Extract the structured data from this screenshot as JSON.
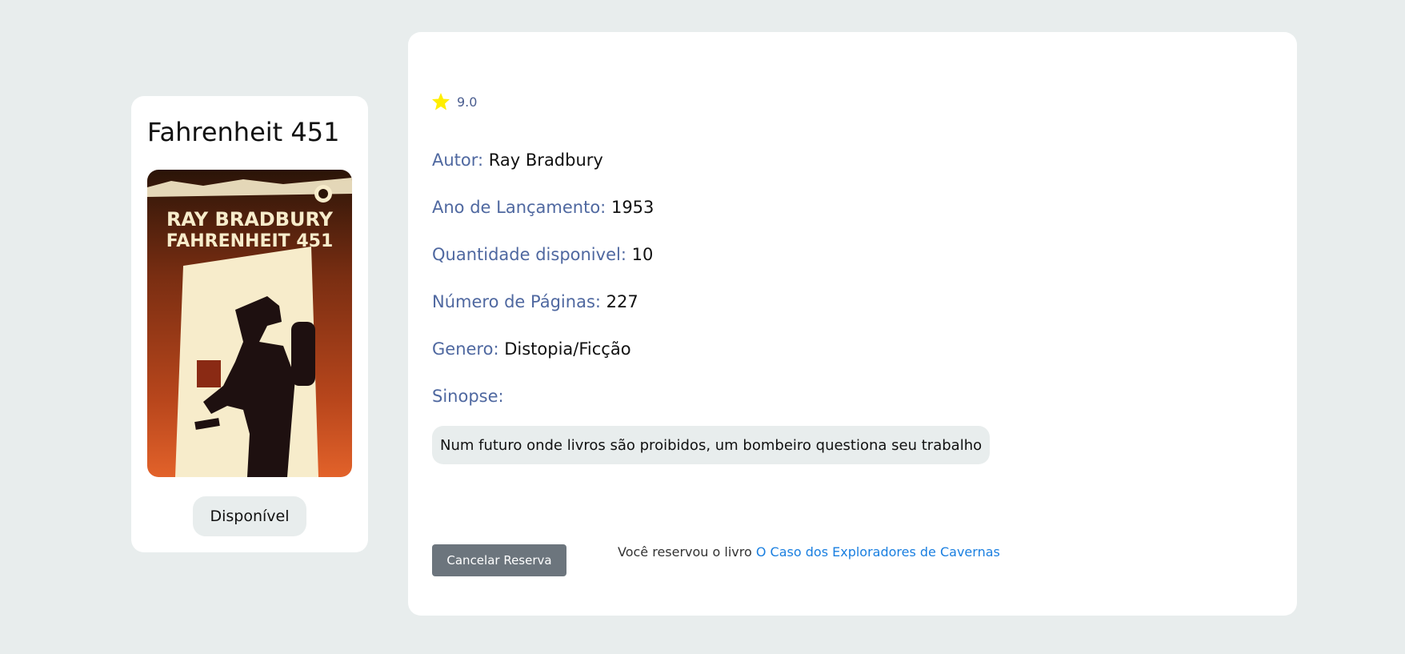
{
  "book": {
    "title": "Fahrenheit 451",
    "cover_text_author": "RAY BRADBURY",
    "cover_text_title": "FAHRENHEIT 451",
    "status": "Disponível"
  },
  "details": {
    "rating": "9.0",
    "rating_icon": "star-icon",
    "star_color": "#ffee00",
    "fields": [
      {
        "label": "Autor:",
        "value": "Ray Bradbury"
      },
      {
        "label": "Ano de Lançamento:",
        "value": "1953"
      },
      {
        "label": "Quantidade disponivel:",
        "value": "10"
      },
      {
        "label": "Número de Páginas:",
        "value": "227"
      },
      {
        "label": "Genero:",
        "value": "Distopia/Ficção"
      },
      {
        "label": "Sinopse:",
        "value": ""
      }
    ],
    "synopsis": "Num futuro onde livros são proibidos, um bombeiro questiona seu trabalho"
  },
  "reservation": {
    "cancel_label": "Cancelar Reserva",
    "message_prefix": "Você reservou o livro",
    "reserved_book_link": "O Caso dos Exploradores de Cavernas"
  },
  "colors": {
    "label": "#4f68a0",
    "button_gray": "#6c757d",
    "link": "#1a7fe0",
    "background": "#e8eded"
  }
}
